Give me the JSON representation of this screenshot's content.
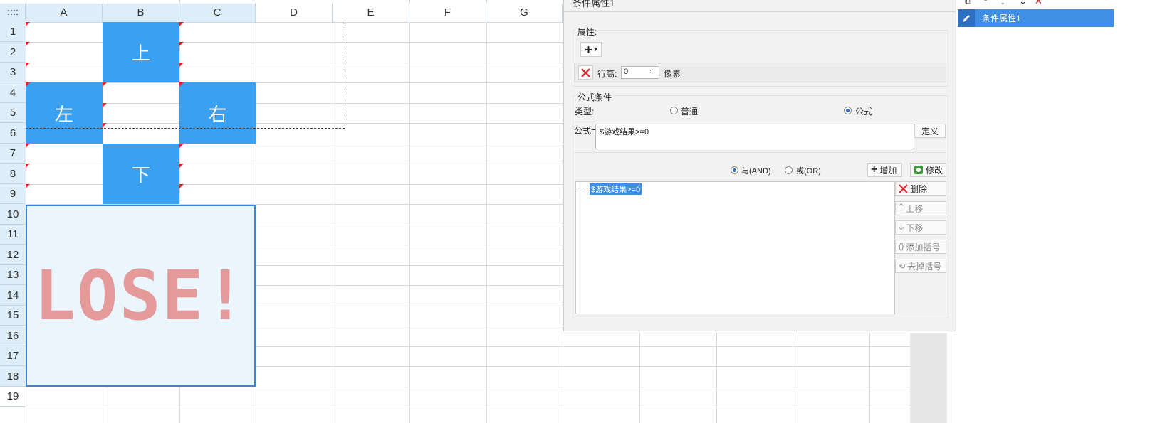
{
  "sheet": {
    "columns": [
      "A",
      "B",
      "C",
      "D",
      "E",
      "F",
      "G"
    ],
    "rows": [
      "1",
      "2",
      "3",
      "4",
      "5",
      "6",
      "7",
      "8",
      "9",
      "10",
      "11",
      "12",
      "13",
      "14",
      "15",
      "16",
      "17",
      "18",
      "19"
    ],
    "cells": {
      "up": "上",
      "left": "左",
      "right": "右",
      "down": "下"
    },
    "lose_text": "LOSE!"
  },
  "dialog": {
    "title": "条件属性1",
    "attributes": {
      "group_label": "属性:",
      "add_symbol": "+",
      "row_height_label": "行高:",
      "row_height_value": "0",
      "unit": "像素"
    },
    "formula_condition": {
      "group_label": "公式条件",
      "type_label": "类型:",
      "type_options": [
        "普通",
        "公式"
      ],
      "selected_type": "公式",
      "formula_label": "公式=",
      "formula_value": "$游戏结果>=0",
      "define_button": "定义",
      "logic_options": [
        "与(AND)",
        "或(OR)"
      ],
      "selected_logic": "与(AND)",
      "add_button": "增加",
      "modify_button": "修改",
      "list_items": [
        "$游戏结果>=0"
      ],
      "side_buttons": {
        "delete": "删除",
        "move_up": "上移",
        "move_down": "下移",
        "add_bracket": "添加括号",
        "remove_bracket": "去掉括号"
      }
    }
  },
  "right_panel": {
    "items": [
      "条件属性1"
    ]
  },
  "colors": {
    "cell_blue": "#3aa1f2",
    "lose_text": "#e59a9a",
    "selection": "#3f8fe4"
  }
}
